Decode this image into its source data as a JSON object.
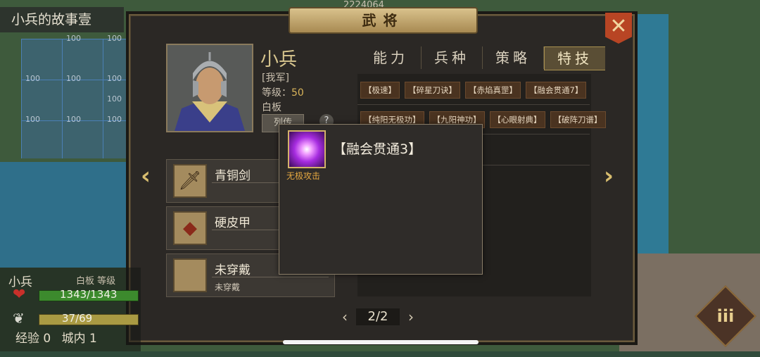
{
  "window": {
    "top_left_title": "小兵的故事壹",
    "top_partial_number": "2224064",
    "title": "武将",
    "close_icon": "close-x-icon"
  },
  "map_labels": [
    "100",
    "100",
    "100",
    "100",
    "100",
    "100",
    "100",
    "100",
    "100"
  ],
  "hero": {
    "name": "小兵",
    "faction": "[我军]",
    "level_label": "等级：",
    "level_value": "50",
    "quality": "白板",
    "biography_button": "列传",
    "help_button": "?"
  },
  "tabs": [
    {
      "label": "能力",
      "active": false
    },
    {
      "label": "兵种",
      "active": false
    },
    {
      "label": "策略",
      "active": false
    },
    {
      "label": "特技",
      "active": true
    }
  ],
  "skills": {
    "row1": [
      "【极速】",
      "【碎星刀诀】",
      "【赤焰真罡】",
      "【融会贯通7】"
    ],
    "row2": [
      "【纯阳无极功】",
      "【九阳神功】",
      "【心眼射典】",
      "【破阵刀谱】"
    ]
  },
  "equipment": [
    {
      "name": "青铜剑",
      "sub": "",
      "icon": "sword-icon"
    },
    {
      "name": "硬皮甲",
      "sub": "",
      "icon": "armor-icon"
    },
    {
      "name": "未穿戴",
      "sub": "未穿戴",
      "icon": "empty-slot-icon"
    }
  ],
  "popup": {
    "title": "【融会贯通3】",
    "label": "无极攻击",
    "icon": "purple-burst-skill-icon"
  },
  "pager": {
    "prev": "‹",
    "page": "2/2",
    "next": "›"
  },
  "nav_arrows": {
    "left": "‹",
    "right": "›"
  },
  "status_panel": {
    "name": "小兵",
    "quality_level": "白板 等级",
    "hp": "1343/1343",
    "mp": "37/69",
    "exp_label": "经验",
    "exp_value": "0",
    "city_label": "城内",
    "city_value": "1"
  },
  "menu_button": {
    "label": "iii"
  }
}
